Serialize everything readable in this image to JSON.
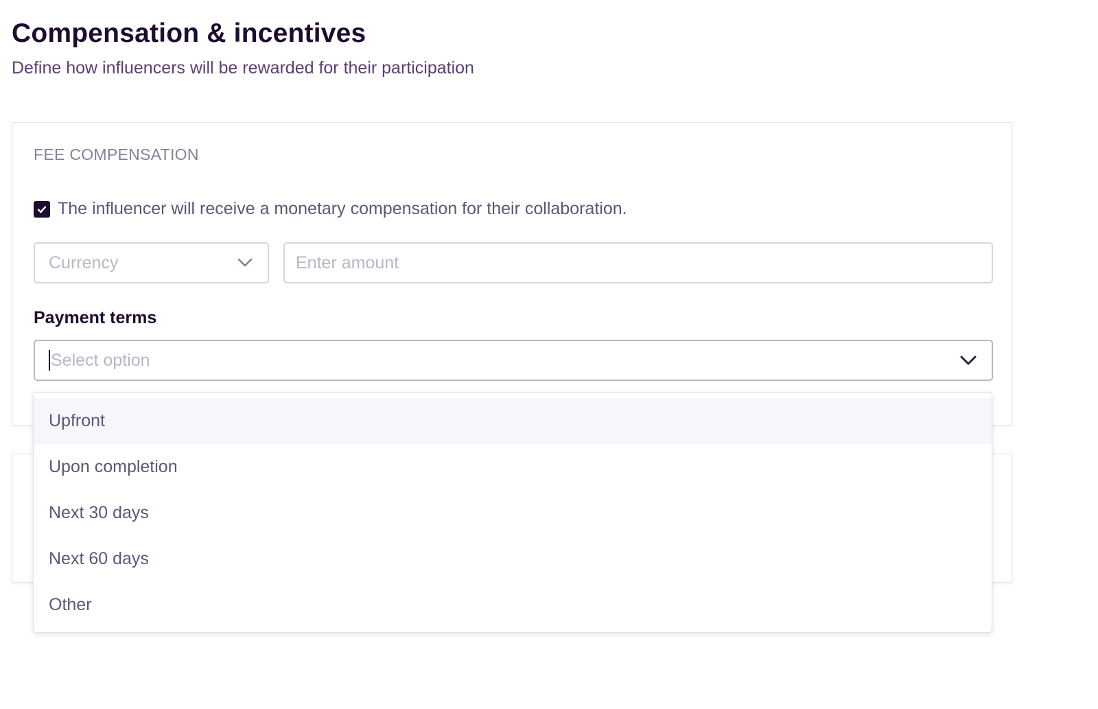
{
  "header": {
    "title": "Compensation & incentives",
    "subtitle": "Define how influencers will be rewarded for their participation"
  },
  "fee_compensation": {
    "section_label": "FEE COMPENSATION",
    "checkbox": {
      "checked": true,
      "label": "The influencer will receive a monetary compensation for their collaboration."
    },
    "currency": {
      "placeholder": "Currency",
      "icon": "chevron-down-icon"
    },
    "amount": {
      "placeholder": "Enter amount",
      "value": ""
    },
    "payment_terms": {
      "label": "Payment terms",
      "placeholder": "Select option",
      "icon": "chevron-down-icon",
      "options": [
        "Upfront",
        "Upon completion",
        "Next 30 days",
        "Next 60 days",
        "Other"
      ],
      "highlighted_index": 0
    }
  },
  "colors": {
    "primary_dark": "#1e0b30",
    "subtitle": "#5b3f74",
    "muted": "#858099",
    "border": "#d7d5dd",
    "highlight": "#f7f6fa"
  }
}
